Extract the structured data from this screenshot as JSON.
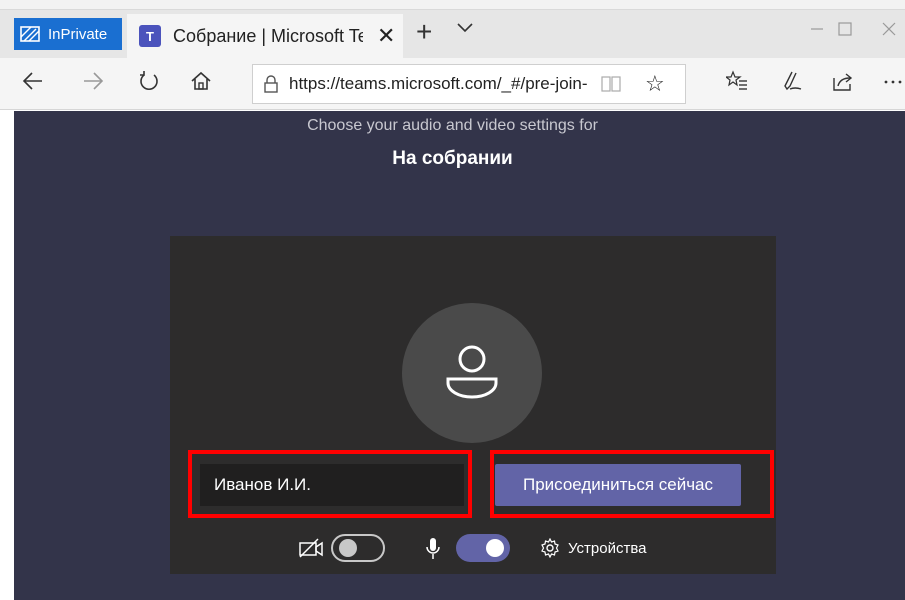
{
  "browser": {
    "inprivate_label": "InPrivate",
    "tab_title": "Собрание | Microsoft Teams",
    "tab_close": "✕",
    "new_tab": "+",
    "url": "https://teams.microsoft.com/_#/pre-join-calling",
    "url_host": "teams.microsoft.com",
    "icons": [
      "back-icon",
      "forward-icon",
      "refresh-icon",
      "home-icon",
      "lock-icon",
      "reading-view-icon",
      "favorite-star-icon",
      "favorites-list-icon",
      "pen-icon",
      "share-icon",
      "more-icon"
    ]
  },
  "page": {
    "subtitle": "Choose your audio and video settings for",
    "meeting_title": "На собрании",
    "name_value": "Иванов И.И.",
    "join_label": "Присоединиться сейчас",
    "devices_label": "Устройства",
    "camera_on": false,
    "mic_on": true
  },
  "colors": {
    "page_bg": "#33344a",
    "card_bg": "#2d2c2c",
    "accent": "#6264a7",
    "highlight": "#ff0000",
    "inprivate": "#1a6fd1"
  }
}
